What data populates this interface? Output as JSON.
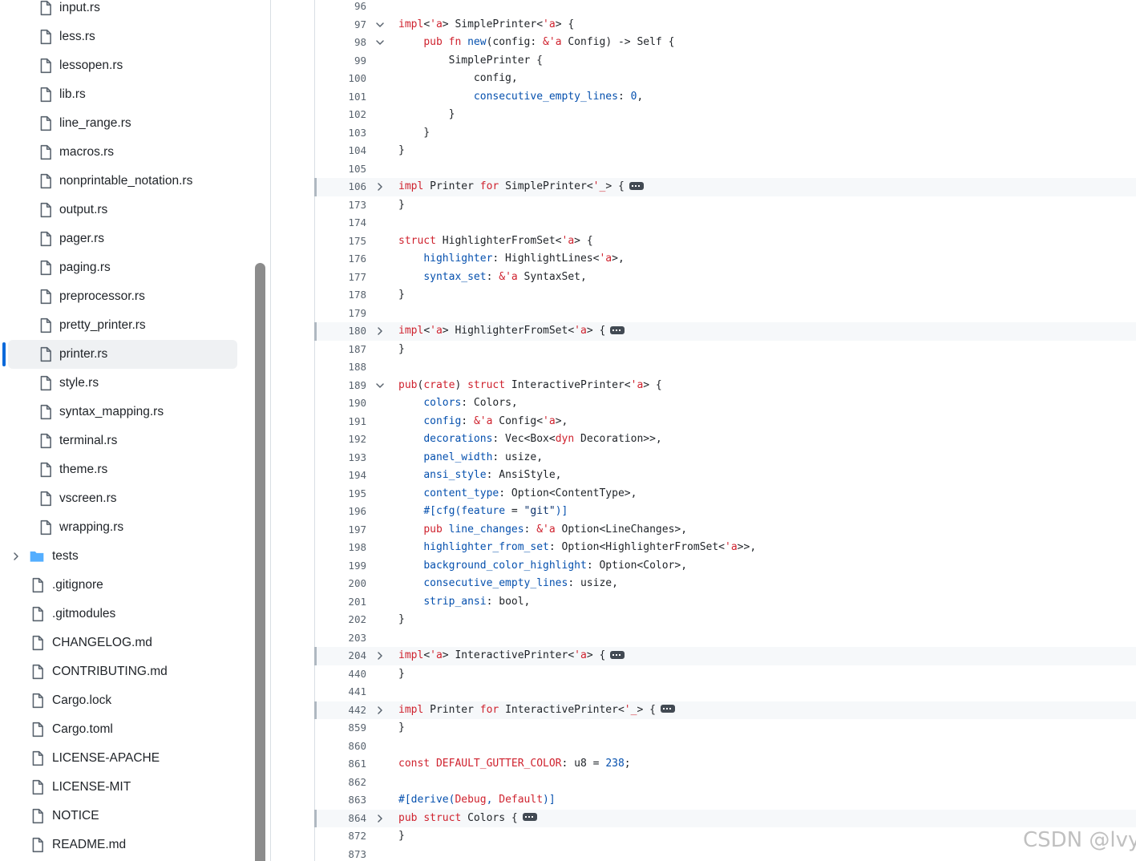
{
  "sidebar": {
    "items": [
      {
        "label": "input.rs",
        "kind": "file",
        "depth": 1
      },
      {
        "label": "less.rs",
        "kind": "file",
        "depth": 1
      },
      {
        "label": "lessopen.rs",
        "kind": "file",
        "depth": 1
      },
      {
        "label": "lib.rs",
        "kind": "file",
        "depth": 1
      },
      {
        "label": "line_range.rs",
        "kind": "file",
        "depth": 1
      },
      {
        "label": "macros.rs",
        "kind": "file",
        "depth": 1
      },
      {
        "label": "nonprintable_notation.rs",
        "kind": "file",
        "depth": 1
      },
      {
        "label": "output.rs",
        "kind": "file",
        "depth": 1
      },
      {
        "label": "pager.rs",
        "kind": "file",
        "depth": 1
      },
      {
        "label": "paging.rs",
        "kind": "file",
        "depth": 1
      },
      {
        "label": "preprocessor.rs",
        "kind": "file",
        "depth": 1
      },
      {
        "label": "pretty_printer.rs",
        "kind": "file",
        "depth": 1
      },
      {
        "label": "printer.rs",
        "kind": "file",
        "depth": 1,
        "active": true
      },
      {
        "label": "style.rs",
        "kind": "file",
        "depth": 1
      },
      {
        "label": "syntax_mapping.rs",
        "kind": "file",
        "depth": 1
      },
      {
        "label": "terminal.rs",
        "kind": "file",
        "depth": 1
      },
      {
        "label": "theme.rs",
        "kind": "file",
        "depth": 1
      },
      {
        "label": "vscreen.rs",
        "kind": "file",
        "depth": 1
      },
      {
        "label": "wrapping.rs",
        "kind": "file",
        "depth": 1
      },
      {
        "label": "tests",
        "kind": "folder",
        "depth": 0
      },
      {
        "label": ".gitignore",
        "kind": "file",
        "depth": 0
      },
      {
        "label": ".gitmodules",
        "kind": "file",
        "depth": 0
      },
      {
        "label": "CHANGELOG.md",
        "kind": "file",
        "depth": 0
      },
      {
        "label": "CONTRIBUTING.md",
        "kind": "file",
        "depth": 0
      },
      {
        "label": "Cargo.lock",
        "kind": "file",
        "depth": 0
      },
      {
        "label": "Cargo.toml",
        "kind": "file",
        "depth": 0
      },
      {
        "label": "LICENSE-APACHE",
        "kind": "file",
        "depth": 0
      },
      {
        "label": "LICENSE-MIT",
        "kind": "file",
        "depth": 0
      },
      {
        "label": "NOTICE",
        "kind": "file",
        "depth": 0
      },
      {
        "label": "README.md",
        "kind": "file",
        "depth": 0
      }
    ]
  },
  "code": {
    "lines": [
      {
        "no": "96",
        "fold": "",
        "collapsed": false,
        "segments": []
      },
      {
        "no": "97",
        "fold": "open",
        "collapsed": false,
        "segments": [
          {
            "c": "k",
            "t": "impl"
          },
          {
            "c": "",
            "t": "<"
          },
          {
            "c": "k",
            "t": "'a"
          },
          {
            "c": "",
            "t": "> SimplePrinter<"
          },
          {
            "c": "k",
            "t": "'a"
          },
          {
            "c": "",
            "t": "> {"
          }
        ]
      },
      {
        "no": "98",
        "fold": "open",
        "collapsed": false,
        "segments": [
          {
            "c": "",
            "t": "    "
          },
          {
            "c": "k",
            "t": "pub"
          },
          {
            "c": "",
            "t": " "
          },
          {
            "c": "k",
            "t": "fn"
          },
          {
            "c": "",
            "t": " "
          },
          {
            "c": "f",
            "t": "new"
          },
          {
            "c": "",
            "t": "(config: "
          },
          {
            "c": "k",
            "t": "&'a"
          },
          {
            "c": "",
            "t": " Config) -> Self {"
          }
        ]
      },
      {
        "no": "99",
        "fold": "",
        "collapsed": false,
        "segments": [
          {
            "c": "",
            "t": "        SimplePrinter {"
          }
        ]
      },
      {
        "no": "100",
        "fold": "",
        "collapsed": false,
        "segments": [
          {
            "c": "",
            "t": "            config,"
          }
        ]
      },
      {
        "no": "101",
        "fold": "",
        "collapsed": false,
        "segments": [
          {
            "c": "",
            "t": "            "
          },
          {
            "c": "f",
            "t": "consecutive_empty_lines"
          },
          {
            "c": "",
            "t": ": "
          },
          {
            "c": "n",
            "t": "0"
          },
          {
            "c": "",
            "t": ","
          }
        ]
      },
      {
        "no": "102",
        "fold": "",
        "collapsed": false,
        "segments": [
          {
            "c": "",
            "t": "        }"
          }
        ]
      },
      {
        "no": "103",
        "fold": "",
        "collapsed": false,
        "segments": [
          {
            "c": "",
            "t": "    }"
          }
        ]
      },
      {
        "no": "104",
        "fold": "",
        "collapsed": false,
        "segments": [
          {
            "c": "",
            "t": "}"
          }
        ]
      },
      {
        "no": "105",
        "fold": "",
        "collapsed": false,
        "segments": []
      },
      {
        "no": "106",
        "fold": "closed",
        "collapsed": true,
        "segments": [
          {
            "c": "k",
            "t": "impl"
          },
          {
            "c": "",
            "t": " Printer "
          },
          {
            "c": "k",
            "t": "for"
          },
          {
            "c": "",
            "t": " SimplePrinter<"
          },
          {
            "c": "k",
            "t": "'_"
          },
          {
            "c": "",
            "t": "> {"
          }
        ],
        "ellipsis": true
      },
      {
        "no": "173",
        "fold": "",
        "collapsed": false,
        "segments": [
          {
            "c": "",
            "t": "}"
          }
        ]
      },
      {
        "no": "174",
        "fold": "",
        "collapsed": false,
        "segments": []
      },
      {
        "no": "175",
        "fold": "",
        "collapsed": false,
        "segments": [
          {
            "c": "k",
            "t": "struct"
          },
          {
            "c": "",
            "t": " HighlighterFromSet<"
          },
          {
            "c": "k",
            "t": "'a"
          },
          {
            "c": "",
            "t": "> {"
          }
        ]
      },
      {
        "no": "176",
        "fold": "",
        "collapsed": false,
        "segments": [
          {
            "c": "",
            "t": "    "
          },
          {
            "c": "f",
            "t": "highlighter"
          },
          {
            "c": "",
            "t": ": HighlightLines<"
          },
          {
            "c": "k",
            "t": "'a"
          },
          {
            "c": "",
            "t": ">,"
          }
        ]
      },
      {
        "no": "177",
        "fold": "",
        "collapsed": false,
        "segments": [
          {
            "c": "",
            "t": "    "
          },
          {
            "c": "f",
            "t": "syntax_set"
          },
          {
            "c": "",
            "t": ": "
          },
          {
            "c": "k",
            "t": "&'a"
          },
          {
            "c": "",
            "t": " SyntaxSet,"
          }
        ]
      },
      {
        "no": "178",
        "fold": "",
        "collapsed": false,
        "segments": [
          {
            "c": "",
            "t": "}"
          }
        ]
      },
      {
        "no": "179",
        "fold": "",
        "collapsed": false,
        "segments": []
      },
      {
        "no": "180",
        "fold": "closed",
        "collapsed": true,
        "segments": [
          {
            "c": "k",
            "t": "impl"
          },
          {
            "c": "",
            "t": "<"
          },
          {
            "c": "k",
            "t": "'a"
          },
          {
            "c": "",
            "t": "> HighlighterFromSet<"
          },
          {
            "c": "k",
            "t": "'a"
          },
          {
            "c": "",
            "t": "> {"
          }
        ],
        "ellipsis": true
      },
      {
        "no": "187",
        "fold": "",
        "collapsed": false,
        "segments": [
          {
            "c": "",
            "t": "}"
          }
        ]
      },
      {
        "no": "188",
        "fold": "",
        "collapsed": false,
        "segments": []
      },
      {
        "no": "189",
        "fold": "open",
        "collapsed": false,
        "segments": [
          {
            "c": "k",
            "t": "pub"
          },
          {
            "c": "",
            "t": "("
          },
          {
            "c": "k",
            "t": "crate"
          },
          {
            "c": "",
            "t": ") "
          },
          {
            "c": "k",
            "t": "struct"
          },
          {
            "c": "",
            "t": " InteractivePrinter<"
          },
          {
            "c": "k",
            "t": "'a"
          },
          {
            "c": "",
            "t": "> {"
          }
        ]
      },
      {
        "no": "190",
        "fold": "",
        "collapsed": false,
        "segments": [
          {
            "c": "",
            "t": "    "
          },
          {
            "c": "f",
            "t": "colors"
          },
          {
            "c": "",
            "t": ": Colors,"
          }
        ]
      },
      {
        "no": "191",
        "fold": "",
        "collapsed": false,
        "segments": [
          {
            "c": "",
            "t": "    "
          },
          {
            "c": "f",
            "t": "config"
          },
          {
            "c": "",
            "t": ": "
          },
          {
            "c": "k",
            "t": "&'a"
          },
          {
            "c": "",
            "t": " Config<"
          },
          {
            "c": "k",
            "t": "'a"
          },
          {
            "c": "",
            "t": ">,"
          }
        ]
      },
      {
        "no": "192",
        "fold": "",
        "collapsed": false,
        "segments": [
          {
            "c": "",
            "t": "    "
          },
          {
            "c": "f",
            "t": "decorations"
          },
          {
            "c": "",
            "t": ": Vec<Box<"
          },
          {
            "c": "k",
            "t": "dyn"
          },
          {
            "c": "",
            "t": " Decoration>>,"
          }
        ]
      },
      {
        "no": "193",
        "fold": "",
        "collapsed": false,
        "segments": [
          {
            "c": "",
            "t": "    "
          },
          {
            "c": "f",
            "t": "panel_width"
          },
          {
            "c": "",
            "t": ": usize,"
          }
        ]
      },
      {
        "no": "194",
        "fold": "",
        "collapsed": false,
        "segments": [
          {
            "c": "",
            "t": "    "
          },
          {
            "c": "f",
            "t": "ansi_style"
          },
          {
            "c": "",
            "t": ": AnsiStyle,"
          }
        ]
      },
      {
        "no": "195",
        "fold": "",
        "collapsed": false,
        "segments": [
          {
            "c": "",
            "t": "    "
          },
          {
            "c": "f",
            "t": "content_type"
          },
          {
            "c": "",
            "t": ": Option<ContentType>,"
          }
        ]
      },
      {
        "no": "196",
        "fold": "",
        "collapsed": false,
        "segments": [
          {
            "c": "",
            "t": "    "
          },
          {
            "c": "f",
            "t": "#[cfg(feature"
          },
          {
            "c": "",
            "t": " = "
          },
          {
            "c": "s",
            "t": "\"git\""
          },
          {
            "c": "f",
            "t": ")]"
          }
        ]
      },
      {
        "no": "197",
        "fold": "",
        "collapsed": false,
        "segments": [
          {
            "c": "",
            "t": "    "
          },
          {
            "c": "k",
            "t": "pub"
          },
          {
            "c": "",
            "t": " "
          },
          {
            "c": "f",
            "t": "line_changes"
          },
          {
            "c": "",
            "t": ": "
          },
          {
            "c": "k",
            "t": "&'a"
          },
          {
            "c": "",
            "t": " Option<LineChanges>,"
          }
        ]
      },
      {
        "no": "198",
        "fold": "",
        "collapsed": false,
        "segments": [
          {
            "c": "",
            "t": "    "
          },
          {
            "c": "f",
            "t": "highlighter_from_set"
          },
          {
            "c": "",
            "t": ": Option<HighlighterFromSet<"
          },
          {
            "c": "k",
            "t": "'a"
          },
          {
            "c": "",
            "t": ">>,"
          }
        ]
      },
      {
        "no": "199",
        "fold": "",
        "collapsed": false,
        "segments": [
          {
            "c": "",
            "t": "    "
          },
          {
            "c": "f",
            "t": "background_color_highlight"
          },
          {
            "c": "",
            "t": ": Option<Color>,"
          }
        ]
      },
      {
        "no": "200",
        "fold": "",
        "collapsed": false,
        "segments": [
          {
            "c": "",
            "t": "    "
          },
          {
            "c": "f",
            "t": "consecutive_empty_lines"
          },
          {
            "c": "",
            "t": ": usize,"
          }
        ]
      },
      {
        "no": "201",
        "fold": "",
        "collapsed": false,
        "segments": [
          {
            "c": "",
            "t": "    "
          },
          {
            "c": "f",
            "t": "strip_ansi"
          },
          {
            "c": "",
            "t": ": bool,"
          }
        ]
      },
      {
        "no": "202",
        "fold": "",
        "collapsed": false,
        "segments": [
          {
            "c": "",
            "t": "}"
          }
        ]
      },
      {
        "no": "203",
        "fold": "",
        "collapsed": false,
        "segments": []
      },
      {
        "no": "204",
        "fold": "closed",
        "collapsed": true,
        "segments": [
          {
            "c": "k",
            "t": "impl"
          },
          {
            "c": "",
            "t": "<"
          },
          {
            "c": "k",
            "t": "'a"
          },
          {
            "c": "",
            "t": "> InteractivePrinter<"
          },
          {
            "c": "k",
            "t": "'a"
          },
          {
            "c": "",
            "t": "> {"
          }
        ],
        "ellipsis": true
      },
      {
        "no": "440",
        "fold": "",
        "collapsed": false,
        "segments": [
          {
            "c": "",
            "t": "}"
          }
        ]
      },
      {
        "no": "441",
        "fold": "",
        "collapsed": false,
        "segments": []
      },
      {
        "no": "442",
        "fold": "closed",
        "collapsed": true,
        "segments": [
          {
            "c": "k",
            "t": "impl"
          },
          {
            "c": "",
            "t": " Printer "
          },
          {
            "c": "k",
            "t": "for"
          },
          {
            "c": "",
            "t": " InteractivePrinter<"
          },
          {
            "c": "k",
            "t": "'_"
          },
          {
            "c": "",
            "t": "> {"
          }
        ],
        "ellipsis": true
      },
      {
        "no": "859",
        "fold": "",
        "collapsed": false,
        "segments": [
          {
            "c": "",
            "t": "}"
          }
        ]
      },
      {
        "no": "860",
        "fold": "",
        "collapsed": false,
        "segments": []
      },
      {
        "no": "861",
        "fold": "",
        "collapsed": false,
        "segments": [
          {
            "c": "k",
            "t": "const"
          },
          {
            "c": "",
            "t": " "
          },
          {
            "c": "k",
            "t": "DEFAULT_GUTTER_COLOR"
          },
          {
            "c": "",
            "t": ": u8 = "
          },
          {
            "c": "n",
            "t": "238"
          },
          {
            "c": "",
            "t": ";"
          }
        ]
      },
      {
        "no": "862",
        "fold": "",
        "collapsed": false,
        "segments": []
      },
      {
        "no": "863",
        "fold": "",
        "collapsed": false,
        "segments": [
          {
            "c": "f",
            "t": "#[derive("
          },
          {
            "c": "k",
            "t": "Debug"
          },
          {
            "c": "f",
            "t": ", "
          },
          {
            "c": "k",
            "t": "Default"
          },
          {
            "c": "f",
            "t": ")]"
          }
        ]
      },
      {
        "no": "864",
        "fold": "closed",
        "collapsed": true,
        "segments": [
          {
            "c": "k",
            "t": "pub"
          },
          {
            "c": "",
            "t": " "
          },
          {
            "c": "k",
            "t": "struct"
          },
          {
            "c": "",
            "t": " Colors {"
          }
        ],
        "ellipsis": true
      },
      {
        "no": "872",
        "fold": "",
        "collapsed": false,
        "segments": [
          {
            "c": "",
            "t": "}"
          }
        ]
      },
      {
        "no": "873",
        "fold": "",
        "collapsed": false,
        "segments": []
      }
    ]
  },
  "watermark": "CSDN @lvy-",
  "colors": {
    "accent": "#0969da",
    "keyword": "#cf222e",
    "entity": "#0550ae",
    "string": "#0a3069",
    "folder": "#54aeff"
  }
}
